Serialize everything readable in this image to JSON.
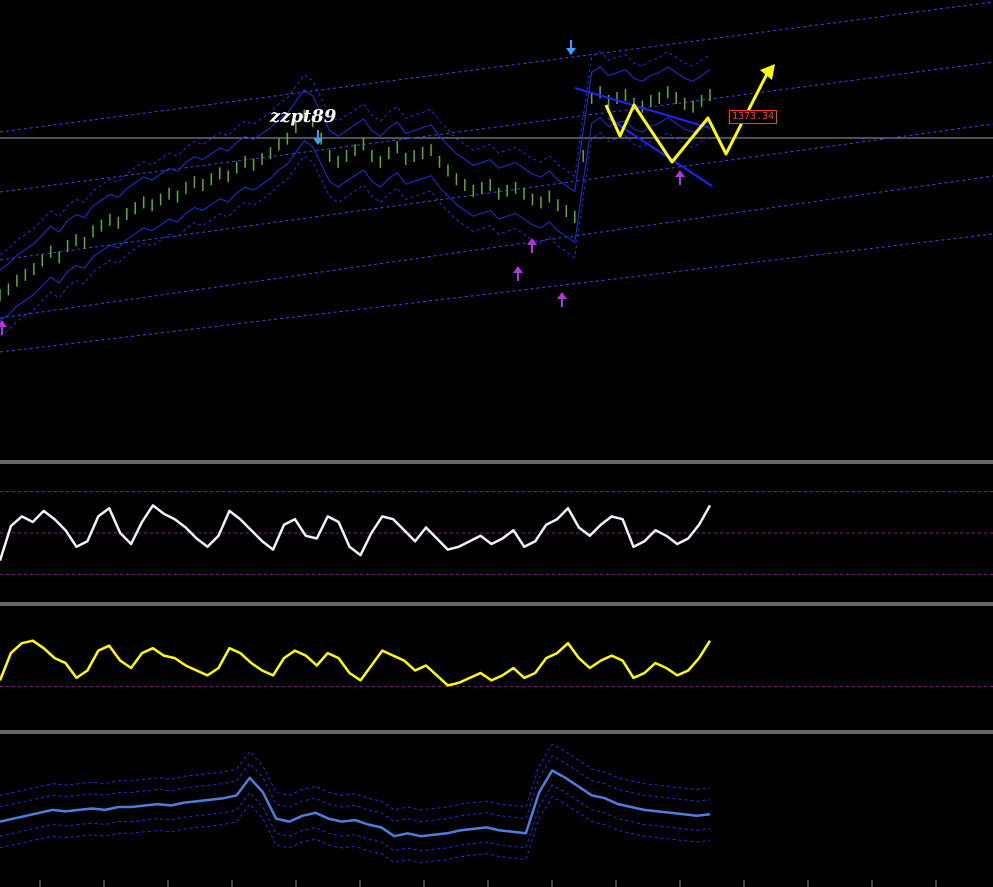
{
  "chart_data": {
    "type": "line",
    "signature_text": "zzpt89",
    "price_label": "1373.34",
    "colors": {
      "background": "#000000",
      "candles": "#5fae2e",
      "bands": "#1f2fe0",
      "fib_lines": "#3a46e8",
      "price_line": "#9aa0a8",
      "arrows_up": "#b433e0",
      "arrows_down": "#3aa0ff",
      "projection": "#ffff00",
      "wedge": "#1e22ff",
      "osc1": "#f2f2ff",
      "osc2": "#ffff00",
      "osc3_main": "#4a7fe0",
      "osc_levels": "#8a1a8a"
    },
    "panels": [
      {
        "name": "price",
        "ylim": [
          0,
          100
        ]
      },
      {
        "name": "oscillator-1",
        "ylim": [
          0,
          100
        ],
        "levels": [
          20,
          50,
          80
        ]
      },
      {
        "name": "oscillator-2",
        "ylim": [
          0,
          100
        ],
        "levels": [
          35
        ]
      },
      {
        "name": "oscillator-3",
        "ylim": [
          0,
          100
        ]
      }
    ],
    "series": [
      {
        "panel": 0,
        "values": [
          12,
          14,
          17,
          19,
          21,
          24,
          27,
          25,
          29,
          31,
          30,
          34,
          36,
          38,
          37,
          40,
          42,
          44,
          43,
          45,
          47,
          46,
          49,
          51,
          50,
          52,
          54,
          53,
          56,
          58,
          57,
          59,
          61,
          64,
          66,
          70,
          74,
          72,
          66,
          60,
          58,
          60,
          62,
          64,
          60,
          58,
          61,
          63,
          59,
          60,
          61,
          62,
          58,
          55,
          52,
          50,
          48,
          49,
          50,
          47,
          48,
          49,
          47,
          45,
          44,
          46,
          43,
          41,
          39,
          60,
          80,
          82,
          79,
          80,
          81,
          78,
          77,
          79,
          80,
          82,
          80,
          78,
          77,
          79,
          81
        ]
      },
      {
        "panel": 1,
        "values": [
          30,
          55,
          62,
          58,
          66,
          60,
          52,
          40,
          44,
          62,
          68,
          50,
          42,
          58,
          70,
          64,
          60,
          54,
          46,
          40,
          48,
          66,
          60,
          52,
          44,
          38,
          56,
          60,
          48,
          46,
          62,
          58,
          40,
          34,
          50,
          62,
          60,
          52,
          44,
          54,
          46,
          38,
          40,
          44,
          48,
          42,
          46,
          52,
          40,
          44,
          56,
          60,
          68,
          54,
          48,
          56,
          62,
          60,
          40,
          44,
          52,
          48,
          42,
          46,
          56,
          70
        ]
      },
      {
        "panel": 2,
        "values": [
          40,
          62,
          70,
          72,
          66,
          58,
          54,
          42,
          48,
          64,
          68,
          56,
          50,
          62,
          66,
          60,
          58,
          52,
          48,
          44,
          50,
          66,
          62,
          54,
          48,
          44,
          58,
          64,
          60,
          52,
          62,
          58,
          46,
          40,
          52,
          64,
          60,
          56,
          48,
          52,
          44,
          36,
          38,
          42,
          46,
          40,
          44,
          50,
          42,
          46,
          58,
          62,
          70,
          58,
          50,
          56,
          60,
          56,
          42,
          46,
          54,
          50,
          44,
          48,
          58,
          72
        ]
      },
      {
        "panel": 3,
        "values": [
          40,
          42,
          44,
          46,
          48,
          47,
          48,
          49,
          48,
          50,
          50,
          51,
          52,
          51,
          53,
          54,
          55,
          56,
          58,
          70,
          60,
          42,
          40,
          44,
          46,
          42,
          40,
          41,
          38,
          36,
          30,
          32,
          30,
          31,
          32,
          34,
          35,
          36,
          34,
          33,
          32,
          60,
          75,
          70,
          64,
          58,
          56,
          52,
          50,
          48,
          47,
          46,
          45,
          44,
          45
        ]
      }
    ]
  }
}
